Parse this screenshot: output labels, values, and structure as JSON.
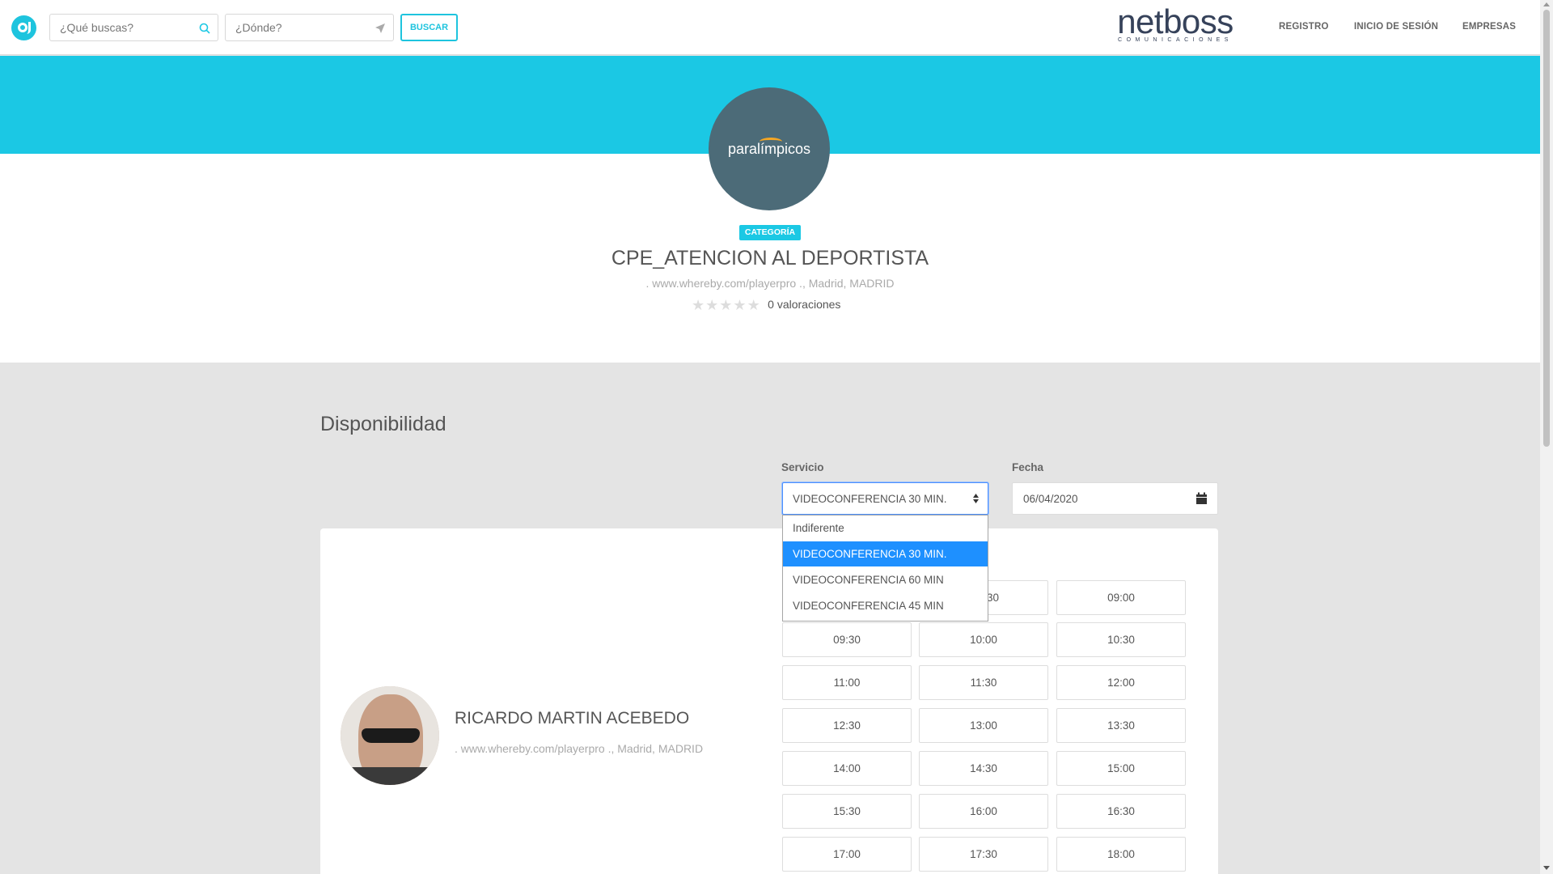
{
  "header": {
    "search_placeholder": "¿Qué buscas?",
    "location_placeholder": "¿Dónde?",
    "search_button": "BUSCAR",
    "brand_name": "netboss",
    "brand_sub": "COMUNICACIONES",
    "nav": {
      "register": "REGISTRO",
      "login": "INICIO DE SESIÓN",
      "business": "EMPRESAS"
    }
  },
  "business": {
    "logo_text": "paralímpicos",
    "badge": "CATEGORÍA",
    "title": "CPE_ATENCION AL DEPORTISTA",
    "address": ". www.whereby.com/playerpro ., Madrid, MADRID",
    "rating_stars": 0,
    "rating_count": "0 valoraciones"
  },
  "availability": {
    "title": "Disponibilidad",
    "service_label": "Servicio",
    "service_selected": "VIDEOCONFERENCIA 30 MIN.",
    "service_options": [
      "Indiferente",
      "VIDEOCONFERENCIA 30 MIN.",
      "VIDEOCONFERENCIA 60 MIN",
      "VIDEOCONFERENCIA 45 MIN"
    ],
    "date_label": "Fecha",
    "date_value": "06/04/2020",
    "professional": {
      "name": "RICARDO MARTIN ACEBEDO",
      "address": ". www.whereby.com/playerpro ., Madrid, MADRID"
    },
    "slots_partially_hidden": "30",
    "slots": [
      "09:00",
      "09:30",
      "10:00",
      "10:30",
      "11:00",
      "11:30",
      "12:00",
      "12:30",
      "13:00",
      "13:30",
      "14:00",
      "14:30",
      "15:00",
      "15:30",
      "16:00",
      "16:30",
      "17:00",
      "17:30",
      "18:00"
    ]
  },
  "colors": {
    "accent": "#1bc8e4",
    "selected_option": "#1e90ff",
    "brand_text": "#36425a"
  },
  "icons": [
    "logo-icon",
    "search-icon",
    "location-arrow-icon",
    "sort-arrows-icon",
    "calendar-icon",
    "star-icon"
  ]
}
